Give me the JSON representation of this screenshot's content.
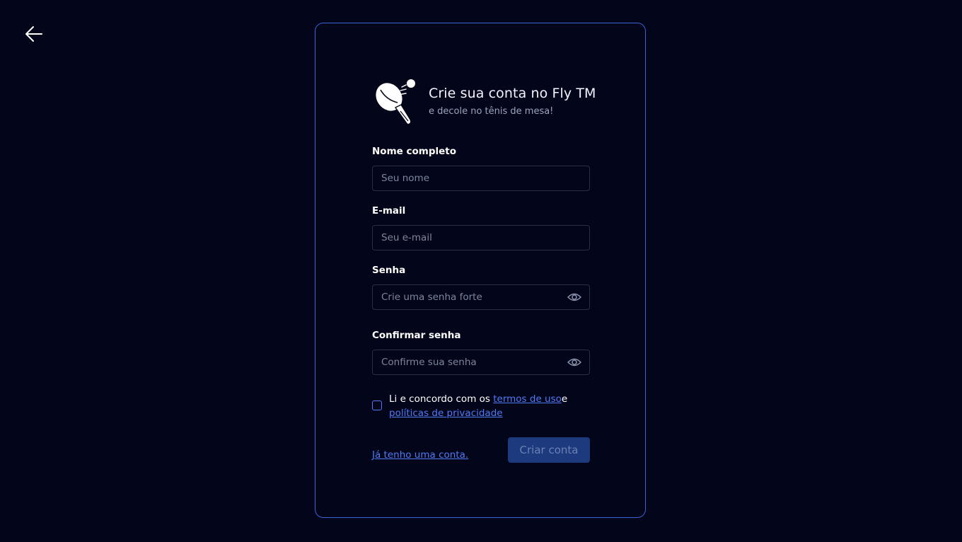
{
  "nav": {
    "back_icon": "arrow-left-icon"
  },
  "header": {
    "logo_icon": "ping-pong-paddle-icon",
    "title": "Crie sua conta no Fly TM",
    "subtitle": "e decole no tênis de mesa!"
  },
  "form": {
    "name": {
      "label": "Nome completo",
      "placeholder": "Seu nome",
      "value": ""
    },
    "email": {
      "label": "E-mail",
      "placeholder": "Seu e-mail",
      "value": ""
    },
    "password": {
      "label": "Senha",
      "placeholder": "Crie uma senha forte",
      "value": "",
      "toggle_icon": "eye-icon"
    },
    "confirm_password": {
      "label": "Confirmar senha",
      "placeholder": "Confirme sua senha",
      "value": "",
      "toggle_icon": "eye-icon"
    },
    "terms": {
      "checked": false,
      "prefix": "Li e concordo com os ",
      "terms_link": "termos de uso",
      "conjunction": "e",
      "privacy_link": "políticas de privacidade"
    },
    "login_link": "Já tenho uma conta.",
    "submit_label": "Criar conta"
  },
  "colors": {
    "background": "#03061a",
    "card_border": "#3b63d6",
    "link": "#4f7bf7",
    "button_bg": "#1d3a7e",
    "button_text": "#6c80b4"
  }
}
